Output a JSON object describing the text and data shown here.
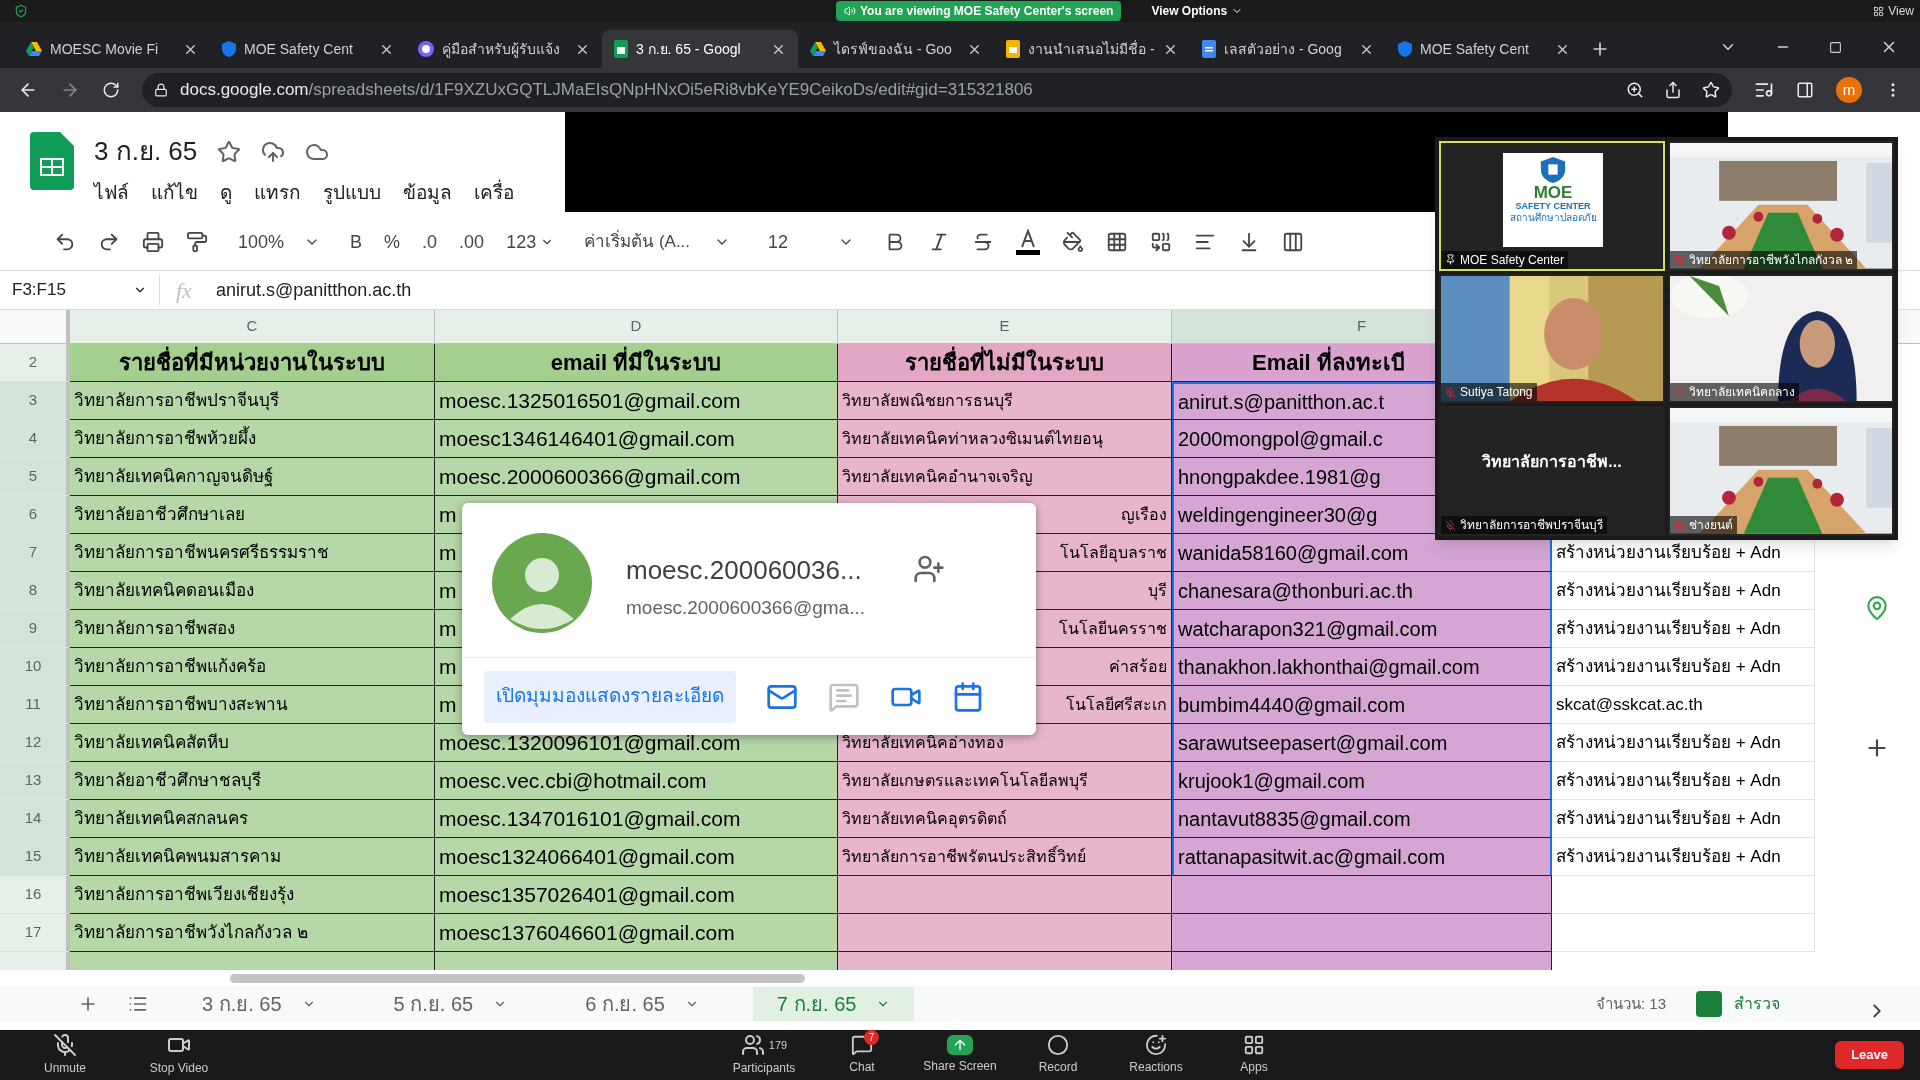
{
  "zoom_top": {
    "banner": "You are viewing MOE Safety Center's screen",
    "view_options": "View Options",
    "view": "View"
  },
  "browser": {
    "tabs": [
      {
        "title": "MOESC Movie Fi",
        "kind": "drive",
        "selected": false
      },
      {
        "title": "MOE Safety Cent",
        "kind": "shield",
        "selected": false
      },
      {
        "title": "คู่มือสำหรับผู้รับแจ้ง",
        "kind": "circle",
        "selected": false
      },
      {
        "title": "3 ก.ย. 65 - Googl",
        "kind": "sheets",
        "selected": true
      },
      {
        "title": "ไดรฟ์ของฉัน - Goo",
        "kind": "drive",
        "selected": false
      },
      {
        "title": "งานนำเสนอไม่มีชื่อ -",
        "kind": "slides",
        "selected": false
      },
      {
        "title": "เลสตัวอย่าง - Goog",
        "kind": "docs",
        "selected": false
      },
      {
        "title": "MOE Safety Cent",
        "kind": "shield",
        "selected": false
      }
    ],
    "url_host": "docs.google.com",
    "url_path": "/spreadsheets/d/1F9XZUxGQTLJMaEIsQNpHNxOi5eRi8vbKeYE9CeikoDs/edit#gid=315321806",
    "avatar": "m"
  },
  "sheet": {
    "title": "3 ก.ย. 65",
    "menus": [
      "ไฟล์",
      "แก้ไข",
      "ดู",
      "แทรก",
      "รูปแบบ",
      "ข้อมูล",
      "เครื่อ"
    ],
    "toolbar": {
      "zoom": "100%",
      "currency": "B",
      "percent": "%",
      "dec_less": ".0",
      "dec_more": ".00",
      "format": "123",
      "font": "ค่าเริ่มต้น (A...",
      "size": "12"
    },
    "name_box": "F3:F15",
    "fx": "fx",
    "formula": "anirut.s@panitthon.ac.th",
    "columns": [
      "C",
      "D",
      "E",
      "F"
    ],
    "rows": [
      {
        "number": "2",
        "kind": "header",
        "c": "รายชื่อที่มีหน่วยงานในระบบ",
        "d": "email ที่มีในระบบ",
        "e": "รายชื่อที่ไม่มีในระบบ",
        "f": "Email ที่ลงทะเบี",
        "f_selected": false,
        "e_clipped": false
      },
      {
        "number": "3",
        "kind": "data",
        "c": "วิทยาลัยการอาชีพปราจีนบุรี",
        "d": "moesc.1325016501@gmail.com",
        "e": "วิทยาลัยพณิชยการธนบุรี",
        "f": "anirut.s@panitthon.ac.t",
        "f_selected": true,
        "e_clipped": false
      },
      {
        "number": "4",
        "kind": "data",
        "c": "วิทยาลัยการอาชีพห้วยผึ้ง",
        "d": "moesc1346146401@gmail.com",
        "e": "วิทยาลัยเทคนิคท่าหลวงซิเมนต์ไทยอนุ",
        "f": "2000mongpol@gmail.c",
        "f_selected": true,
        "e_clipped": false
      },
      {
        "number": "5",
        "kind": "data",
        "c": "วิทยาลัยเทคนิคกาญจนดิษฐ์",
        "d": "moesc.2000600366@gmail.com",
        "e": "วิทยาลัยเทคนิคอำนาจเจริญ",
        "f": "hnongpakdee.1981@g",
        "f_selected": true,
        "e_clipped": false
      },
      {
        "number": "6",
        "kind": "data",
        "c": "วิทยาลัยอาชีวศึกษาเลย",
        "d": "m",
        "e": "ญเรือง",
        "f": "weldingengineer30@g",
        "f_selected": true,
        "e_clipped": true
      },
      {
        "number": "7",
        "kind": "data",
        "c": "วิทยาลัยการอาชีพนครศรีธรรมราช",
        "d": "m",
        "e": "โนโลยีอุบลราช",
        "f": "wanida58160@gmail.com",
        "g": "สร้างหน่วยงานเรียบร้อย + Adn",
        "f_selected": true,
        "e_clipped": true
      },
      {
        "number": "8",
        "kind": "data",
        "c": "วิทยาลัยเทคนิคดอนเมือง",
        "d": "m",
        "e": "บุรี",
        "f": "chanesara@thonburi.ac.th",
        "g": "สร้างหน่วยงานเรียบร้อย + Adn",
        "f_selected": true,
        "e_clipped": true
      },
      {
        "number": "9",
        "kind": "data",
        "c": "วิทยาลัยการอาชีพสอง",
        "d": "m",
        "e": "โนโลยีนครราช",
        "f": "watcharapon321@gmail.com",
        "g": "สร้างหน่วยงานเรียบร้อย + Adn",
        "f_selected": true,
        "e_clipped": true
      },
      {
        "number": "10",
        "kind": "data",
        "c": "วิทยาลัยการอาชีพแก้งคร้อ",
        "d": "m",
        "e": "ค่าสร้อย",
        "f": "thanakhon.lakhonthai@gmail.com",
        "g": "สร้างหน่วยงานเรียบร้อย + Adn",
        "f_selected": true,
        "e_clipped": true
      },
      {
        "number": "11",
        "kind": "data",
        "c": "วิทยาลัยการอาชีพบางสะพาน",
        "d": "m",
        "e": "โนโลยีศรีสะเก",
        "f": "bumbim4440@gmail.com",
        "g": "skcat@sskcat.ac.th",
        "f_selected": true,
        "e_clipped": true
      },
      {
        "number": "12",
        "kind": "data",
        "c": "วิทยาลัยเทคนิคสัตหีบ",
        "d": "moesc.1320096101@gmail.com",
        "e": "วิทยาลัยเทคนิคอ่างทอง",
        "f": "sarawutseepasert@gmail.com",
        "g": "สร้างหน่วยงานเรียบร้อย + Adn",
        "f_selected": true,
        "e_clipped": false
      },
      {
        "number": "13",
        "kind": "data",
        "c": "วิทยาลัยอาชีวศึกษาชลบุรี",
        "d": "moesc.vec.cbi@hotmail.com",
        "e": "วิทยาลัยเกษตรและเทคโนโลยีลพบุรี",
        "f": "krujook1@gmail.com",
        "g": "สร้างหน่วยงานเรียบร้อย + Adn",
        "f_selected": true,
        "e_clipped": false
      },
      {
        "number": "14",
        "kind": "data",
        "c": "วิทยาลัยเทคนิคสกลนคร",
        "d": "moesc.1347016101@gmail.com",
        "e": "วิทยาลัยเทคนิคอุตรดิตถ์",
        "f": "nantavut8835@gmail.com",
        "g": "สร้างหน่วยงานเรียบร้อย + Adn",
        "f_selected": true,
        "e_clipped": false
      },
      {
        "number": "15",
        "kind": "data",
        "c": "วิทยาลัยเทคนิคพนมสารคาม",
        "d": "moesc1324066401@gmail.com",
        "e": "วิทยาลัยการอาชีพรัตนประสิทธิ์วิทย์",
        "f": "rattanapasitwit.ac@gmail.com",
        "g": "สร้างหน่วยงานเรียบร้อย + Adn",
        "f_selected": true,
        "e_clipped": false
      },
      {
        "number": "16",
        "kind": "data",
        "c": "วิทยาลัยการอาชีพเวียงเชียงรุ้ง",
        "d": "moesc1357026401@gmail.com",
        "f_selected": false
      },
      {
        "number": "17",
        "kind": "data",
        "c": "วิทยาลัยการอาชีพวังไกลกังวล ๒",
        "d": "moesc1376046601@gmail.com",
        "f_selected": false
      }
    ],
    "sheet_tabs": [
      {
        "label": "3 ก.ย. 65",
        "selected": false
      },
      {
        "label": "5 ก.ย. 65",
        "selected": false
      },
      {
        "label": "6 ก.ย. 65",
        "selected": false
      },
      {
        "label": "7 ก.ย. 65",
        "selected": true
      }
    ],
    "count": "จำนวน: 13",
    "explore": "สำรวจ"
  },
  "profile_card": {
    "name": "moesc.200060036...",
    "email": "moesc.2000600366@gma...",
    "open_button": "เปิดมุมมองแสดงรายละเอียด"
  },
  "video_panel": {
    "tiles": [
      {
        "kind": "logo",
        "name": "MOE Safety Center",
        "pinned": true,
        "muted": false,
        "active": true,
        "logo_title": "MOE",
        "logo_subtitle": "SAFETY CENTER",
        "logo_caption": "สถานศึกษาปลอดภัย"
      },
      {
        "kind": "video",
        "name": "วิทยาลัยการอาชีพวังไกลกังวล ๒",
        "pinned": false,
        "muted": true,
        "active": false
      },
      {
        "kind": "video",
        "name": "Sutiya Tatong",
        "pinned": false,
        "muted": true,
        "active": false
      },
      {
        "kind": "video",
        "name": "วิทยาลัยเทคนิคถลาง",
        "pinned": false,
        "muted": true,
        "active": false
      },
      {
        "kind": "name",
        "name": "วิทยาลัยการอาชีพปราจีนบุรี",
        "display": "วิทยาลัยการอาชีพ...",
        "pinned": false,
        "muted": true,
        "active": false
      },
      {
        "kind": "video",
        "name": "ช่างยนต์",
        "pinned": false,
        "muted": true,
        "active": false
      }
    ]
  },
  "meeting_controls": {
    "left": [
      {
        "label": "Unmute",
        "kind": "mic"
      },
      {
        "label": "Stop Video",
        "kind": "video"
      }
    ],
    "center": [
      {
        "label": "Participants",
        "kind": "participants",
        "count": "179"
      },
      {
        "label": "Chat",
        "kind": "chat",
        "badge": "7"
      },
      {
        "label": "Share Screen",
        "kind": "share"
      },
      {
        "label": "Record",
        "kind": "record"
      },
      {
        "label": "Reactions",
        "kind": "reactions"
      },
      {
        "label": "Apps",
        "kind": "apps"
      }
    ],
    "leave": "Leave"
  }
}
